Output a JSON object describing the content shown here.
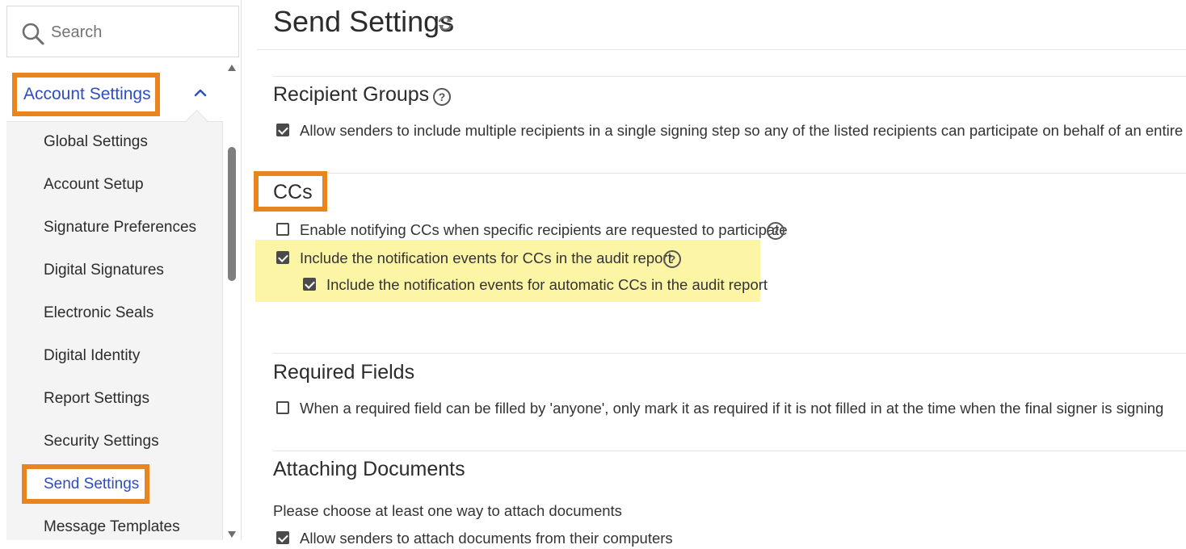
{
  "search": {
    "placeholder": "Search"
  },
  "sidebar": {
    "section_label": "Account Settings",
    "items": [
      {
        "label": "Global Settings"
      },
      {
        "label": "Account Setup"
      },
      {
        "label": "Signature Preferences"
      },
      {
        "label": "Digital Signatures"
      },
      {
        "label": "Electronic Seals"
      },
      {
        "label": "Digital Identity"
      },
      {
        "label": "Report Settings"
      },
      {
        "label": "Security Settings"
      },
      {
        "label": "Send Settings",
        "selected": true
      },
      {
        "label": "Message Templates"
      }
    ]
  },
  "main": {
    "title": "Send Settings",
    "recipient_groups": {
      "title": "Recipient Groups",
      "options": [
        {
          "label": "Allow senders to include multiple recipients in a single signing step so any of the listed recipients can participate on behalf of an entire group",
          "checked": true
        }
      ]
    },
    "ccs": {
      "title": "CCs",
      "options": [
        {
          "label": "Enable notifying CCs when specific recipients are requested to participate",
          "checked": false
        },
        {
          "label": "Include the notification events for CCs in the audit report",
          "checked": true
        },
        {
          "label": "Include the notification events for automatic CCs in the audit report",
          "checked": true
        }
      ]
    },
    "required_fields": {
      "title": "Required Fields",
      "options": [
        {
          "label": "When a required field can be filled by 'anyone', only mark it as required if it is not filled in at the time when the final signer is signing",
          "checked": false
        }
      ]
    },
    "attaching_documents": {
      "title": "Attaching Documents",
      "instruction": "Please choose at least one way to attach documents",
      "options": [
        {
          "label": "Allow senders to attach documents from their computers",
          "checked": true
        }
      ]
    }
  },
  "help_glyph": "?",
  "colors": {
    "highlight_border": "#e8851f",
    "selected_text": "#2d4dc0",
    "yellow_highlight": "#fdf5a6",
    "nav_background": "#f4f4f4"
  }
}
